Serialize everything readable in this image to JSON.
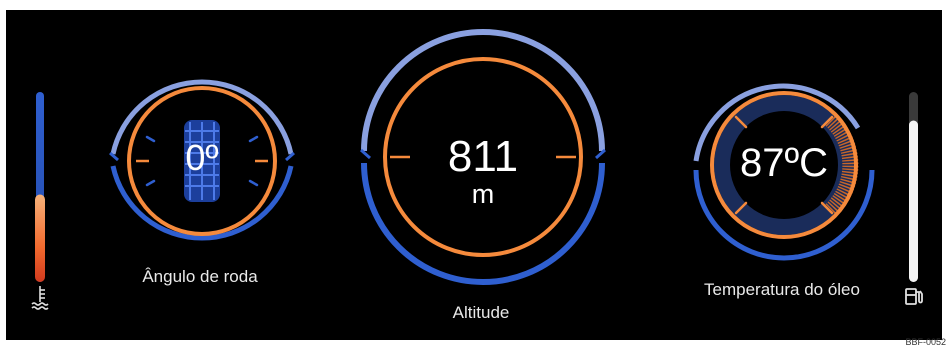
{
  "gauges": {
    "wheel_angle": {
      "value": "0º",
      "label": "Ângulo de roda"
    },
    "altitude": {
      "value": "811",
      "unit": "m",
      "label": "Altitude"
    },
    "oil_temp": {
      "value": "87ºC",
      "label": "Temperatura do óleo"
    }
  },
  "side_bars": {
    "coolant": {
      "icon": "coolant-temperature-icon",
      "level": 0.45
    },
    "fuel": {
      "icon": "fuel-pump-icon",
      "level": 0.85
    }
  },
  "reference_code": "BBF-0052",
  "colors": {
    "background": "#000000",
    "orange": "#f58a3c",
    "blue": "#2f5fd0",
    "periwinkle": "#8aa0e0",
    "text": "#e9e9e9"
  }
}
